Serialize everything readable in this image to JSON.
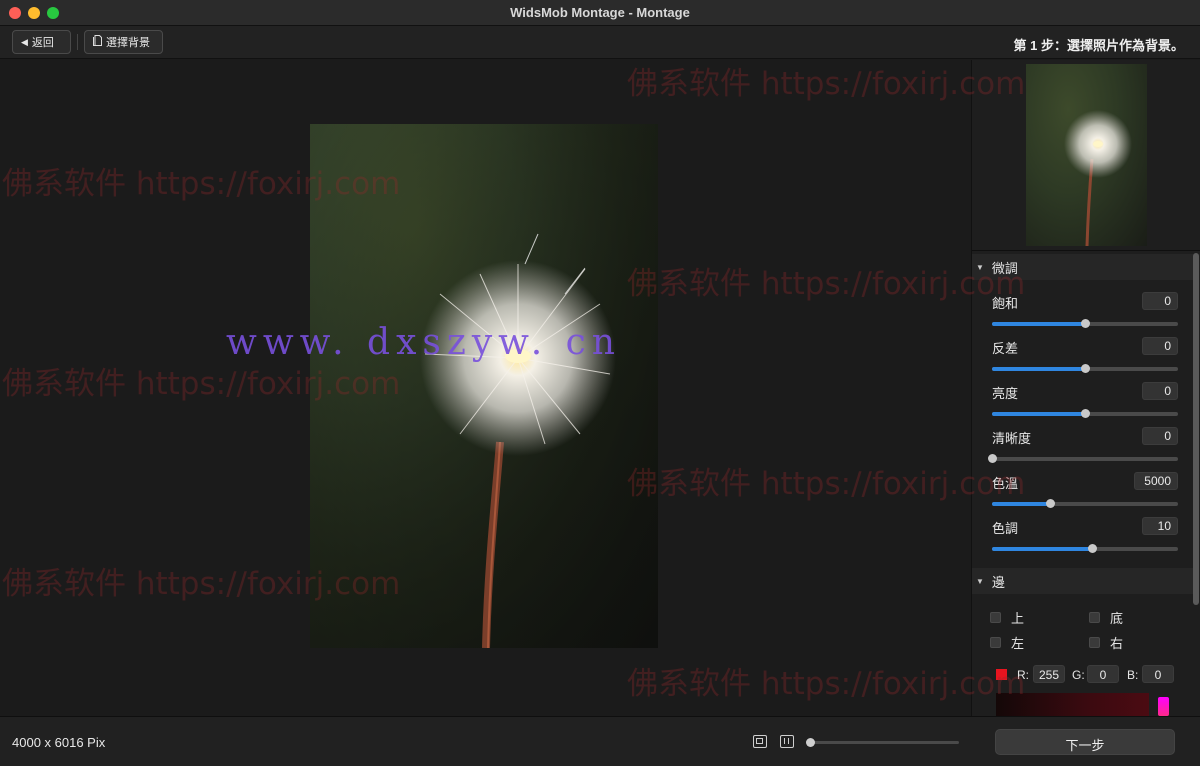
{
  "window": {
    "title": "WidsMob Montage - Montage"
  },
  "toolbar": {
    "back_label": "返回",
    "choose_bg_label": "選擇背景",
    "step_text": "第 1 步：選擇照片作為背景。"
  },
  "adjust": {
    "section_title": "微調",
    "items": [
      {
        "label": "飽和",
        "value": "0",
        "fraction": 0.5
      },
      {
        "label": "反差",
        "value": "0",
        "fraction": 0.5
      },
      {
        "label": "亮度",
        "value": "0",
        "fraction": 0.5
      },
      {
        "label": "清晰度",
        "value": "0",
        "fraction": 0.0
      },
      {
        "label": "色溫",
        "value": "5000",
        "fraction": 0.31
      },
      {
        "label": "色調",
        "value": "10",
        "fraction": 0.54
      }
    ]
  },
  "border": {
    "section_title": "邊",
    "sides": {
      "top": "上",
      "bottom": "底",
      "left": "左",
      "right": "右"
    },
    "color": {
      "hex": "#e8141f",
      "r_label": "R:",
      "r": "255",
      "g_label": "G:",
      "g": "0",
      "b_label": "B:",
      "b": "0"
    }
  },
  "status": {
    "dimensions": "4000 x 6016 Pix",
    "zoom_fraction": 0.02
  },
  "footer": {
    "next_label": "下一步"
  },
  "watermarks": {
    "site": "佛系软件 https://foxirj.com",
    "site2": "www. dxszyw. cn"
  }
}
